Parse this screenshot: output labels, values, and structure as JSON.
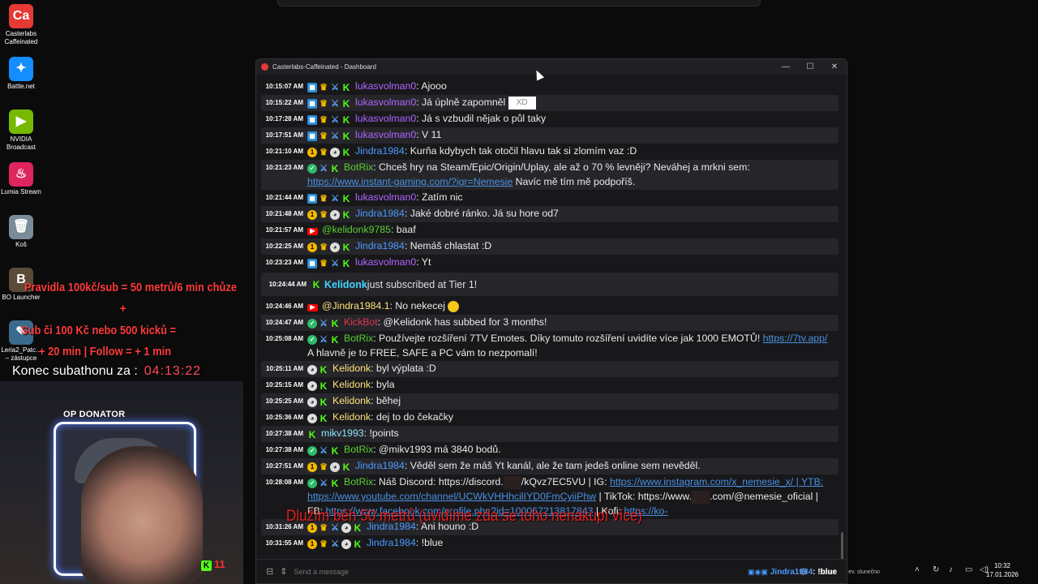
{
  "desktop_icons": [
    {
      "label": "Casterlabs Caffeinated",
      "icon": "casterlabs-icon",
      "color": "#e53935",
      "glyph": "Ca"
    },
    {
      "label": "Battle.net",
      "icon": "battlenet-icon",
      "color": "#148eff",
      "glyph": "✦"
    },
    {
      "label": "NVIDIA Broadcast",
      "icon": "nvidia-icon",
      "color": "#76b900",
      "glyph": "▶"
    },
    {
      "label": "Lumia Stream",
      "icon": "lumia-icon",
      "color": "#e0245e",
      "glyph": "♨"
    },
    {
      "label": "Koš",
      "icon": "recycle-bin-icon",
      "color": "#7a8c9a",
      "glyph": "🗑"
    },
    {
      "label": "BO Launcher",
      "icon": "bo-launcher-icon",
      "color": "#5a4a38",
      "glyph": "B"
    },
    {
      "label": "Leria2_Patc... – zástupce",
      "icon": "shortcut-icon",
      "color": "#3a6b8c",
      "glyph": "✎"
    }
  ],
  "stream_overlay": {
    "rules_line1": "Pravidla 100kč/sub = 50 metrů/6 min chůze",
    "rules_plus": "+",
    "rules_line2": "Sub či 100 Kč nebo 500 kicků =",
    "rules_line3": "+ 20 min | Follow = + 1 min",
    "subathon_label": "Konec subathonu za :",
    "subathon_time": "04:13:22",
    "op_donator": "OP DONATOR",
    "kick_count": "11",
    "red_banner": "Dlužím běh 50 metrů (uvidíme zda se toho nenakupí více)"
  },
  "window": {
    "title": "Casterlabs-Caffeinated - Dashboard",
    "minimize": "—",
    "maximize": "☐",
    "close": "✕"
  },
  "chat": [
    {
      "ts": "10:15:07 AM",
      "badges": [
        "sub",
        "crown",
        "sword",
        "kick"
      ],
      "name": "lukasvolman0",
      "color": "purple",
      "parts": [
        {
          "t": ": Ajooo"
        }
      ]
    },
    {
      "ts": "10:15:22 AM",
      "badges": [
        "sub",
        "crown",
        "sword",
        "kick"
      ],
      "name": "lukasvolman0",
      "color": "purple",
      "parts": [
        {
          "t": ": Já úplně zapomněl "
        },
        {
          "emote": "XD"
        }
      ]
    },
    {
      "ts": "10:17:28 AM",
      "badges": [
        "sub",
        "crown",
        "sword",
        "kick"
      ],
      "name": "lukasvolman0",
      "color": "purple",
      "parts": [
        {
          "t": ": Já s vzbudil nějak o půl taky"
        }
      ]
    },
    {
      "ts": "10:17:51 AM",
      "badges": [
        "sub",
        "crown",
        "sword",
        "kick"
      ],
      "name": "lukasvolman0",
      "color": "purple",
      "parts": [
        {
          "t": ": V 11"
        }
      ]
    },
    {
      "ts": "10:21:10 AM",
      "badges": [
        "gift",
        "crown",
        "face",
        "kick"
      ],
      "name": "Jindra1984",
      "color": "blue",
      "parts": [
        {
          "t": ": Kurňa kdybych tak otočil hlavu tak si zlomím vaz :D"
        }
      ]
    },
    {
      "ts": "10:21:23 AM",
      "badges": [
        "bot",
        "sword",
        "kick"
      ],
      "name": "BotRix",
      "color": "green",
      "parts": [
        {
          "t": ": Chceš hry na Steam/Epic/Origin/Uplay, ale až o 70 % levněji? Neváhej a mrkni sem: "
        },
        {
          "link": "https://www.instant-gaming.com/?igr=Nemesie"
        },
        {
          "t": " Navíc mě tím mě podpoříš."
        }
      ]
    },
    {
      "ts": "10:21:44 AM",
      "badges": [
        "sub",
        "crown",
        "sword",
        "kick"
      ],
      "name": "lukasvolman0",
      "color": "purple",
      "parts": [
        {
          "t": ": Zatím nic"
        }
      ]
    },
    {
      "ts": "10:21:48 AM",
      "badges": [
        "gift",
        "crown",
        "face",
        "kick"
      ],
      "name": "Jindra1984",
      "color": "blue",
      "parts": [
        {
          "t": ": Jaké dobré ránko. Já su hore od7"
        }
      ]
    },
    {
      "ts": "10:21:57 AM",
      "badges": [
        "yt"
      ],
      "name": "@kelidonk9785",
      "color": "green",
      "parts": [
        {
          "t": ": baaf"
        }
      ]
    },
    {
      "ts": "10:22:25 AM",
      "badges": [
        "gift",
        "crown",
        "face",
        "kick"
      ],
      "name": "Jindra1984",
      "color": "blue",
      "parts": [
        {
          "t": ": Nemáš chlastat :D"
        }
      ]
    },
    {
      "ts": "10:23:23 AM",
      "badges": [
        "sub",
        "crown",
        "sword",
        "kick"
      ],
      "name": "lukasvolman0",
      "color": "purple",
      "parts": [
        {
          "t": ": Yt"
        }
      ]
    },
    {
      "alert": true,
      "ts": "10:24:44 AM",
      "name": "Kelidonk",
      "text": " just subscribed at Tier 1!"
    },
    {
      "ts": "10:24:46 AM",
      "badges": [
        "yt"
      ],
      "name": "@Jindra1984.1",
      "color": "kelid",
      "parts": [
        {
          "t": ": No nekecej "
        },
        {
          "smile": true
        }
      ]
    },
    {
      "ts": "10:24:47 AM",
      "badges": [
        "bot",
        "sword",
        "kick"
      ],
      "name": "KickBot",
      "color": "red",
      "parts": [
        {
          "t": ": @Kelidonk has subbed for 3 months!"
        }
      ]
    },
    {
      "ts": "10:25:08 AM",
      "badges": [
        "bot",
        "sword",
        "kick"
      ],
      "name": "BotRix",
      "color": "green",
      "parts": [
        {
          "t": ": Používejte rozšíření 7TV Emotes. Díky tomuto rozšíření uvidíte více jak 1000 EMOTŮ! "
        },
        {
          "link": "https://7tv.app/"
        },
        {
          "t": " A hlavně je to FREE, SAFE a PC vám to nezpomalí!"
        }
      ]
    },
    {
      "ts": "10:25:11 AM",
      "badges": [
        "face",
        "kick"
      ],
      "name": "Kelidonk",
      "color": "kelid",
      "parts": [
        {
          "t": ": byl výplata :D"
        }
      ]
    },
    {
      "ts": "10:25:15 AM",
      "badges": [
        "face",
        "kick"
      ],
      "name": "Kelidonk",
      "color": "kelid",
      "parts": [
        {
          "t": ": byla"
        }
      ]
    },
    {
      "ts": "10:25:25 AM",
      "badges": [
        "face",
        "kick"
      ],
      "name": "Kelidonk",
      "color": "kelid",
      "parts": [
        {
          "t": ": běhej"
        }
      ]
    },
    {
      "ts": "10:25:36 AM",
      "badges": [
        "face",
        "kick"
      ],
      "name": "Kelidonk",
      "color": "kelid",
      "parts": [
        {
          "t": ": dej to do čekačky"
        }
      ]
    },
    {
      "ts": "10:27:38 AM",
      "badges": [
        "kick"
      ],
      "name": "mikv1993",
      "color": "mikv",
      "parts": [
        {
          "t": ": !points"
        }
      ]
    },
    {
      "ts": "10:27:38 AM",
      "badges": [
        "bot",
        "sword",
        "kick"
      ],
      "name": "BotRix",
      "color": "green",
      "parts": [
        {
          "t": ": @mikv1993 má 3840 bodů."
        }
      ]
    },
    {
      "ts": "10:27:51 AM",
      "badges": [
        "gift",
        "crown",
        "face",
        "kick"
      ],
      "name": "Jindra1984",
      "color": "blue",
      "parts": [
        {
          "t": ": Věděl sem že máš Yt kanál, ale že tam jedeš online sem nevěděl."
        }
      ]
    },
    {
      "ts": "10:28:08 AM",
      "badges": [
        "bot",
        "sword",
        "kick"
      ],
      "name": "BotRix",
      "color": "green",
      "parts": [
        {
          "t": ": Náš Discord: https://discord."
        },
        {
          "emote_dark": true
        },
        {
          "t": "/kQvz7EC5VU | IG: "
        },
        {
          "link": "https://www.instagram.com/x_nemesie_x/ | YTB: https://www.youtube.com/channel/UCWkVHHhcilIYD0FmCyiiPhw"
        },
        {
          "t": " | TikTok: https://www."
        },
        {
          "emote_dark": true
        },
        {
          "t": ".com/@nemesie_oficial | FB: "
        },
        {
          "link": "https://www.facebook.com/profile.php?id=100067213817843"
        },
        {
          "t": " | Kofi: "
        },
        {
          "link": "https://ko-"
        }
      ]
    },
    {
      "ts": "10:31:26 AM",
      "badges": [
        "gift",
        "crown",
        "sword",
        "face",
        "kick"
      ],
      "name": "Jindra1984",
      "color": "blue",
      "parts": [
        {
          "t": ": Ani houno :D"
        }
      ]
    },
    {
      "ts": "10:31:55 AM",
      "badges": [
        "gift",
        "crown",
        "sword",
        "face",
        "kick"
      ],
      "name": "Jindra1984",
      "color": "blue",
      "parts": [
        {
          "t": ": !blue"
        }
      ]
    }
  ],
  "input": {
    "placeholder": "Send a message",
    "send_label": "Send"
  },
  "taskbar": {
    "last_user": "Jindra1984",
    "last_msg": ": !blue",
    "weather": "ev. slunečno",
    "time": "10:32",
    "date": "17.01.2026"
  }
}
